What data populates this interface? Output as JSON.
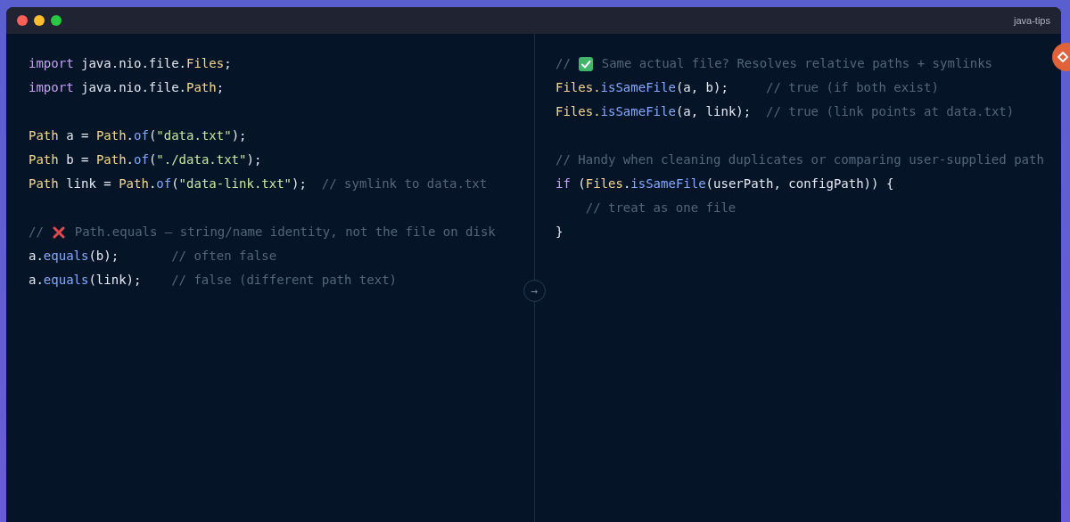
{
  "window": {
    "title": "java-tips"
  },
  "left_panel": {
    "blocks": [
      [
        [
          {
            "kind": "keyword",
            "text": "import"
          },
          {
            "kind": "plain",
            "text": " java.nio.file."
          },
          {
            "kind": "type",
            "text": "Files"
          },
          {
            "kind": "plain",
            "text": ";"
          }
        ],
        [
          {
            "kind": "keyword",
            "text": "import"
          },
          {
            "kind": "plain",
            "text": " java.nio.file."
          },
          {
            "kind": "type",
            "text": "Path"
          },
          {
            "kind": "plain",
            "text": ";"
          }
        ]
      ],
      [
        [
          {
            "kind": "type",
            "text": "Path"
          },
          {
            "kind": "plain",
            "text": " a = "
          },
          {
            "kind": "type",
            "text": "Path"
          },
          {
            "kind": "plain",
            "text": "."
          },
          {
            "kind": "method",
            "text": "of"
          },
          {
            "kind": "plain",
            "text": "("
          },
          {
            "kind": "string",
            "text": "\"data.txt\""
          },
          {
            "kind": "plain",
            "text": ");"
          }
        ],
        [
          {
            "kind": "type",
            "text": "Path"
          },
          {
            "kind": "plain",
            "text": " b = "
          },
          {
            "kind": "type",
            "text": "Path"
          },
          {
            "kind": "plain",
            "text": "."
          },
          {
            "kind": "method",
            "text": "of"
          },
          {
            "kind": "plain",
            "text": "("
          },
          {
            "kind": "string",
            "text": "\"./data.txt\""
          },
          {
            "kind": "plain",
            "text": ");"
          }
        ],
        [
          {
            "kind": "type",
            "text": "Path"
          },
          {
            "kind": "plain",
            "text": " link = "
          },
          {
            "kind": "type",
            "text": "Path"
          },
          {
            "kind": "plain",
            "text": "."
          },
          {
            "kind": "method",
            "text": "of"
          },
          {
            "kind": "plain",
            "text": "("
          },
          {
            "kind": "string",
            "text": "\"data-link.txt\""
          },
          {
            "kind": "plain",
            "text": ");  "
          },
          {
            "kind": "comment",
            "text": "// symlink to data.txt"
          }
        ]
      ],
      [
        [
          {
            "kind": "comment",
            "text": "// "
          },
          {
            "kind": "cross"
          },
          {
            "kind": "comment",
            "text": " Path.equals — string/name identity, not the file on disk"
          }
        ],
        [
          {
            "kind": "plain",
            "text": "a."
          },
          {
            "kind": "method",
            "text": "equals"
          },
          {
            "kind": "plain",
            "text": "(b);       "
          },
          {
            "kind": "comment",
            "text": "// often false"
          }
        ],
        [
          {
            "kind": "plain",
            "text": "a."
          },
          {
            "kind": "method",
            "text": "equals"
          },
          {
            "kind": "plain",
            "text": "(link);    "
          },
          {
            "kind": "comment",
            "text": "// false (different path text)"
          }
        ]
      ]
    ]
  },
  "divider": {
    "arrow": "→"
  },
  "right_panel": {
    "blocks": [
      [
        [
          {
            "kind": "comment",
            "text": "// "
          },
          {
            "kind": "check"
          },
          {
            "kind": "comment",
            "text": " Same actual file? Resolves relative paths + symlinks"
          }
        ],
        [
          {
            "kind": "type",
            "text": "Files."
          },
          {
            "kind": "method",
            "text": "isSameFile"
          },
          {
            "kind": "plain",
            "text": "(a, b);     "
          },
          {
            "kind": "comment",
            "text": "// true (if both exist)"
          }
        ],
        [
          {
            "kind": "type",
            "text": "Files."
          },
          {
            "kind": "method",
            "text": "isSameFile"
          },
          {
            "kind": "plain",
            "text": "(a, link);  "
          },
          {
            "kind": "comment",
            "text": "// true (link points at data.txt)"
          }
        ]
      ],
      [
        [
          {
            "kind": "comment",
            "text": "// Handy when cleaning duplicates or comparing user-supplied path"
          }
        ],
        [
          {
            "kind": "keyword",
            "text": "if"
          },
          {
            "kind": "plain",
            "text": " ("
          },
          {
            "kind": "type",
            "text": "Files"
          },
          {
            "kind": "plain",
            "text": "."
          },
          {
            "kind": "method",
            "text": "isSameFile"
          },
          {
            "kind": "plain",
            "text": "(userPath, configPath)) {"
          }
        ],
        [
          {
            "kind": "comment",
            "text": "    // treat as one file"
          }
        ],
        [
          {
            "kind": "plain",
            "text": "}"
          }
        ]
      ]
    ]
  }
}
